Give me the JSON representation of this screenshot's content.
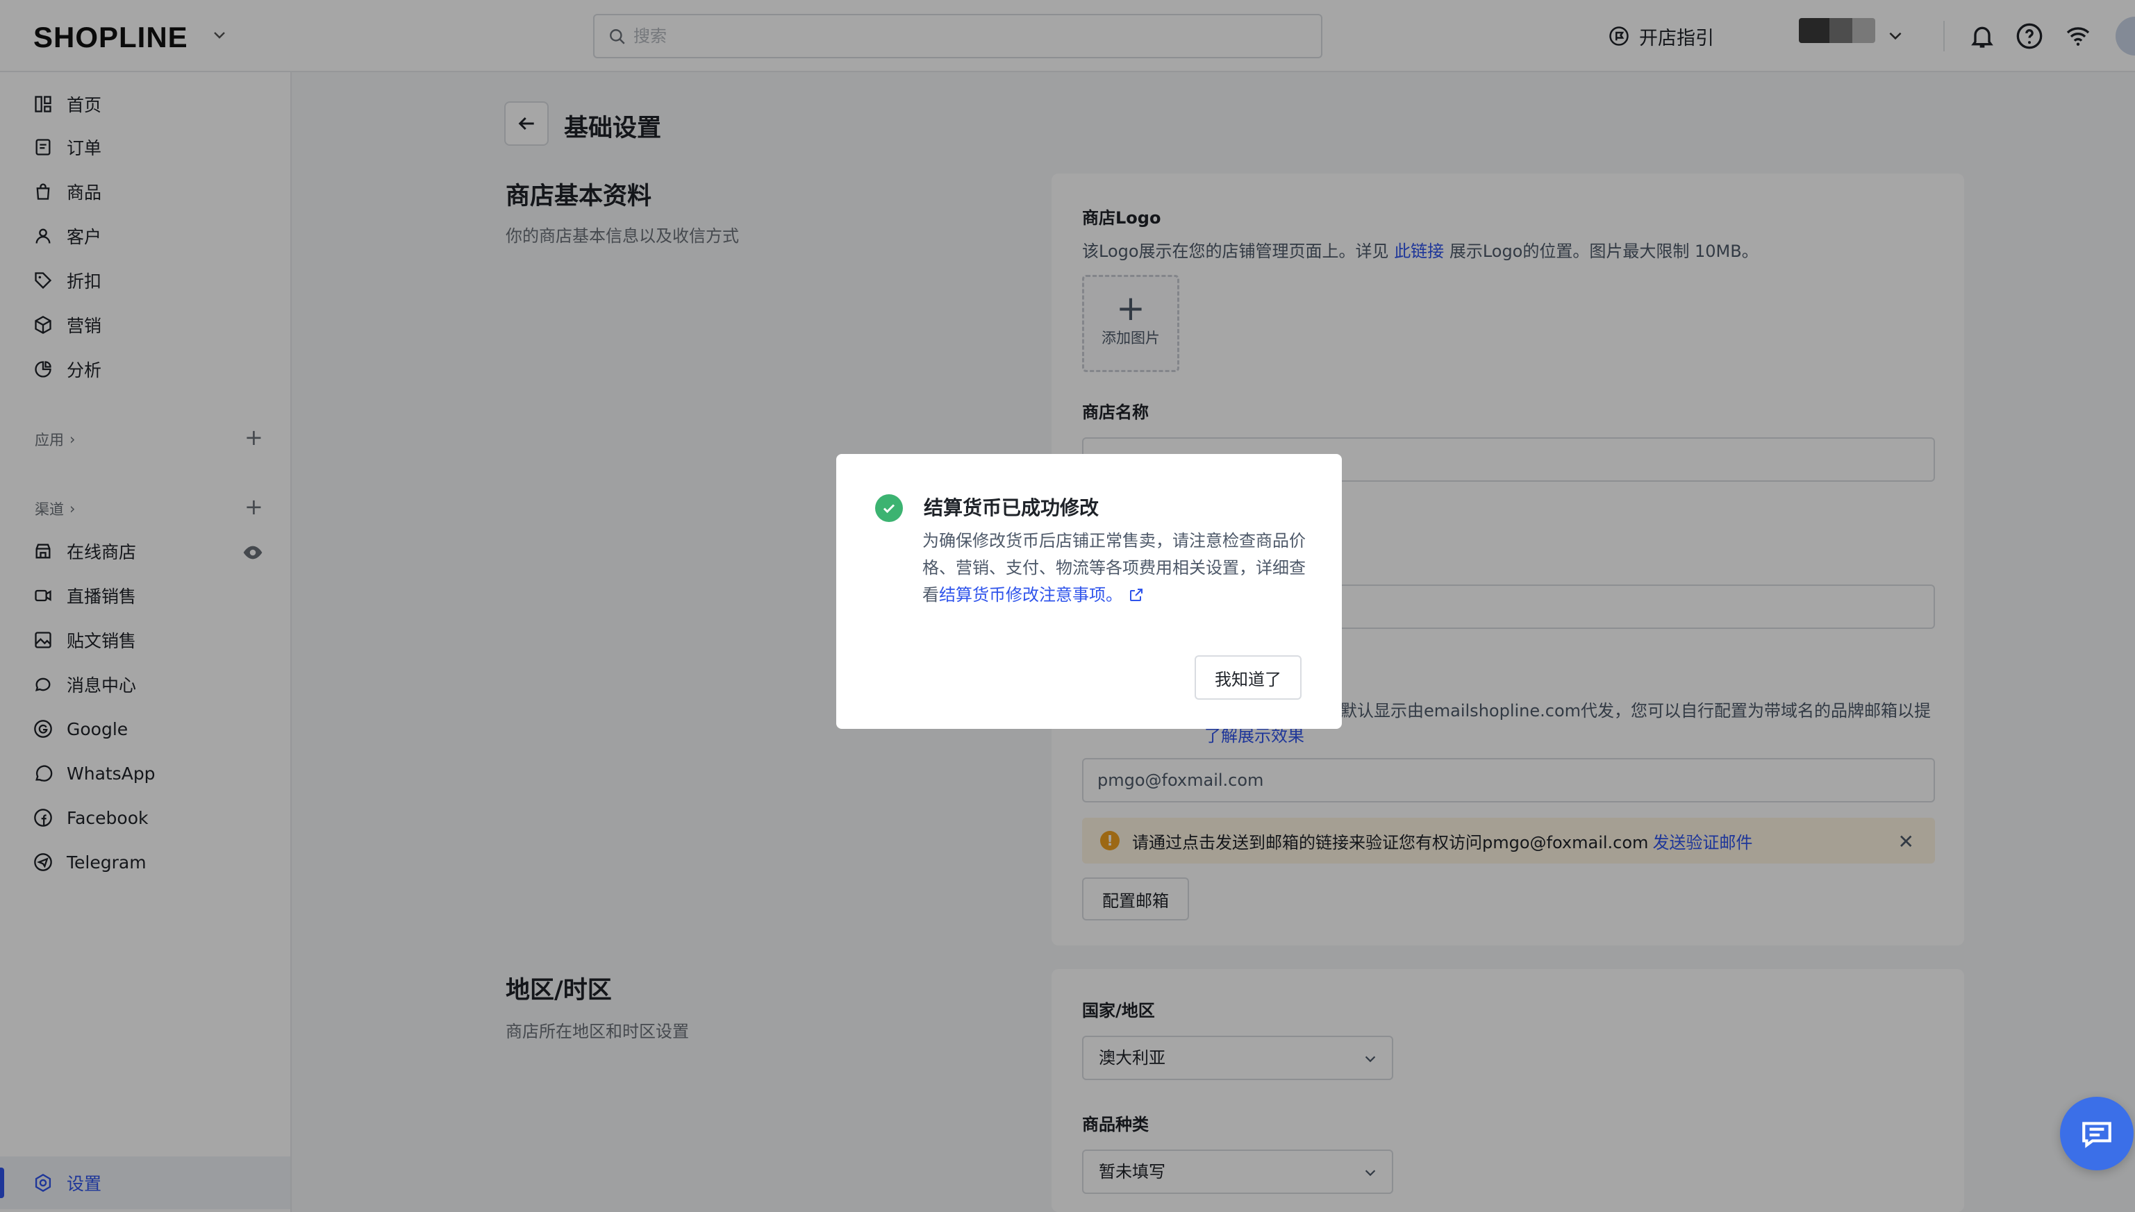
{
  "header": {
    "logo": "SHOPLINE",
    "search_placeholder": "搜索",
    "guide_label": "开店指引"
  },
  "sidebar": {
    "items": [
      {
        "label": "首页",
        "icon": "dashboard-icon"
      },
      {
        "label": "订单",
        "icon": "order-icon"
      },
      {
        "label": "商品",
        "icon": "bag-icon"
      },
      {
        "label": "客户",
        "icon": "user-icon"
      },
      {
        "label": "折扣",
        "icon": "tag-icon"
      },
      {
        "label": "营销",
        "icon": "cube-icon"
      },
      {
        "label": "分析",
        "icon": "pie-icon"
      }
    ],
    "apps_title": "应用",
    "channels_title": "渠道",
    "channels": [
      {
        "label": "在线商店",
        "icon": "store-icon"
      },
      {
        "label": "直播销售",
        "icon": "video-icon"
      },
      {
        "label": "贴文销售",
        "icon": "image-icon"
      },
      {
        "label": "消息中心",
        "icon": "chat-icon"
      },
      {
        "label": "Google",
        "icon": "google-icon"
      },
      {
        "label": "WhatsApp",
        "icon": "whatsapp-icon"
      },
      {
        "label": "Facebook",
        "icon": "facebook-icon"
      },
      {
        "label": "Telegram",
        "icon": "telegram-icon"
      }
    ],
    "settings_label": "设置"
  },
  "page": {
    "title": "基础设置",
    "basic": {
      "title": "商店基本资料",
      "desc": "你的商店基本信息以及收信方式",
      "logo_label": "商店Logo",
      "logo_desc_pre": "该Logo展示在您的店铺管理页面上。详见 ",
      "logo_desc_link": "此链接",
      "logo_desc_post": " 展示Logo的位置。图片最大限制 10MB。",
      "add_image": "添加图片",
      "store_name_label": "商店名称",
      "email_desc_visible": "默认显示由emailshopline.com代发，您可以自行配置为带域名的品牌邮箱以提",
      "email_desc_line2_link": "了解展示效果",
      "email_value": "pmgo@foxmail.com",
      "verify_text": "请通过点击发送到邮箱的链接来验证您有权访问pmgo@foxmail.com ",
      "verify_link": "发送验证邮件",
      "configure_mailbox": "配置邮箱"
    },
    "region": {
      "title": "地区/时区",
      "desc": "商店所在地区和时区设置",
      "country_label": "国家/地区",
      "country_value": "澳大利亚",
      "category_label": "商品种类",
      "category_value": "暂未填写"
    }
  },
  "modal": {
    "title": "结算货币已成功修改",
    "body": "为确保修改货币后店铺正常售卖，请注意检查商品价格、营销、支付、物流等各项费用相关设置，详细查看",
    "link": "结算货币修改注意事项。",
    "button": "我知道了"
  },
  "colors": {
    "accent": "#2f54eb",
    "success": "#3cb371",
    "warning_bg": "#fdf4e2",
    "warning_icon": "#f0a020"
  }
}
